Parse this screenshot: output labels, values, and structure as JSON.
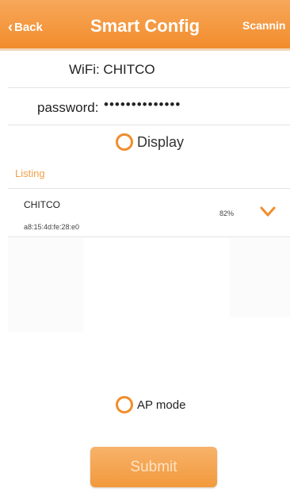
{
  "header": {
    "back_label": "Back",
    "title": "Smart Config",
    "scan_label": "Scannin"
  },
  "wifi": {
    "label": "WiFi: CHITCO"
  },
  "password": {
    "label": "password:",
    "masked_value": "••••••••••••••"
  },
  "display_option": {
    "label": "Display"
  },
  "listing": {
    "label": "Listing",
    "items": [
      {
        "ssid": "CHITCO",
        "mac": "a8:15:4d:fe:28:e0",
        "signal": "82%"
      }
    ]
  },
  "ap_mode": {
    "label": "AP mode"
  },
  "submit": {
    "label": "Submit"
  },
  "colors": {
    "accent": "#f28c2c",
    "listing_label": "#f0a04a"
  },
  "icons": {
    "back": "chevron-left-icon",
    "expand": "chevron-down-icon"
  }
}
